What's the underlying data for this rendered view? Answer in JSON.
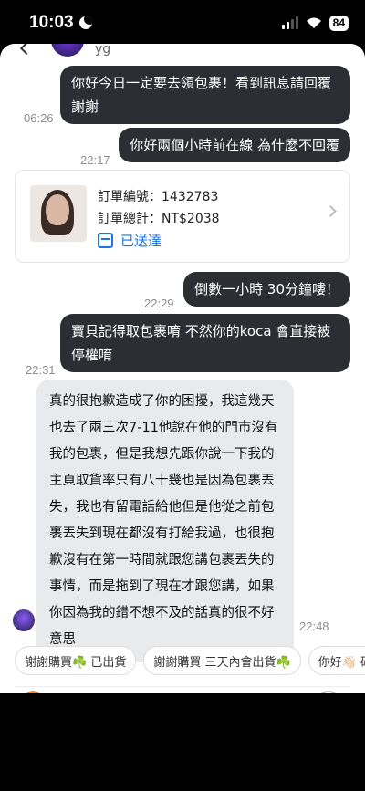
{
  "status_bar": {
    "time": "10:03",
    "battery": "84"
  },
  "header": {
    "name": "yg"
  },
  "messages": {
    "m1": {
      "text": "你好今日一定要去領包裹！看到訊息請回覆謝謝",
      "time": "06:26"
    },
    "m2": {
      "text": "你好兩個小時前在線 為什麼不回覆",
      "time": "22:17"
    },
    "m3": {
      "text": "倒數一小時 30分鐘嘍！",
      "time": "22:29"
    },
    "m4": {
      "text": "寶貝記得取包裹唷 不然你的koca 會直接被停權唷",
      "time": "22:31"
    },
    "m5": {
      "text": "真的很抱歉造成了你的困擾，我這幾天也去了兩三次7-11他說在他的門市沒有我的包裹，但是我想先跟你說一下我的主頁取貨率只有八十幾也是因為包裹丟失，我也有留電話給他但是他從之前包裹丟失到現在都沒有打給我過，也很抱歉沒有在第一時間就跟您講包裹丟失的事情，而是拖到了現在才跟您講，如果你因為我的錯不想不及的話真的很不好意思",
      "time": "22:48"
    }
  },
  "order": {
    "number_label": "訂單編號：1432783",
    "total_label": "訂單總計：NT$2038",
    "status": "已送達"
  },
  "quick_replies": [
    "謝謝購買☘️ 已出貨",
    "謝謝購買 三天內會出貨☘️",
    "你好👋🏻 確認"
  ],
  "colors": {
    "dark_bubble": "#2b2f33",
    "light_bubble": "#e9eaec",
    "accent": "#1a73e8"
  }
}
